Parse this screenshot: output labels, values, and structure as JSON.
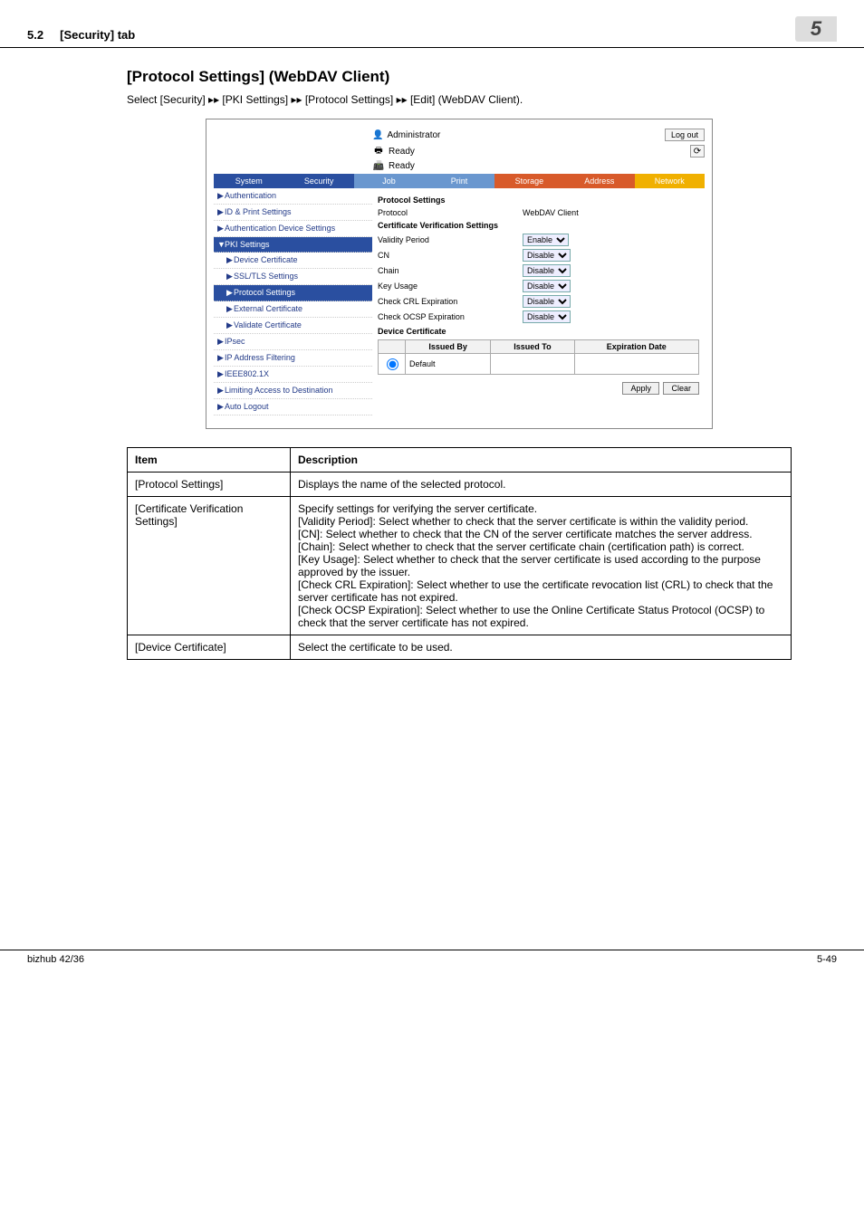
{
  "header": {
    "section": "5.2",
    "section_title": "[Security] tab",
    "chapter_badge": "5"
  },
  "page_title": "[Protocol Settings] (WebDAV Client)",
  "intro_prefix": "Select [Security] ",
  "intro_sep": "▸▸",
  "intro_p1": " [PKI Settings] ",
  "intro_p2": " [Protocol Settings] ",
  "intro_p3": " [Edit] (WebDAV Client).",
  "screenshot": {
    "administrator_label": "Administrator",
    "logout_label": "Log out",
    "ready_label": "Ready",
    "tabs": {
      "system": "System",
      "security": "Security",
      "job": "Job",
      "print": "Print",
      "storage": "Storage",
      "address": "Address",
      "network": "Network"
    },
    "sidebar": {
      "authentication": "Authentication",
      "id_print": "ID & Print Settings",
      "auth_device": "Authentication Device Settings",
      "pki_settings": "PKI Settings",
      "device_cert": "Device Certificate",
      "ssl_tls": "SSL/TLS Settings",
      "protocol_settings": "Protocol Settings",
      "external_cert": "External Certificate",
      "validate_cert": "Validate Certificate",
      "ipsec": "IPsec",
      "ip_filter": "IP Address Filtering",
      "ieee": "IEEE802.1X",
      "limiting": "Limiting Access to Destination",
      "auto_logout": "Auto Logout"
    },
    "main": {
      "protocol_settings_title": "Protocol Settings",
      "protocol_label": "Protocol",
      "protocol_value": "WebDAV Client",
      "cert_verif_title": "Certificate Verification Settings",
      "validity_period": "Validity Period",
      "cn": "CN",
      "chain": "Chain",
      "key_usage": "Key Usage",
      "check_crl": "Check CRL Expiration",
      "check_ocsp": "Check OCSP Expiration",
      "enable": "Enable",
      "disable": "Disable",
      "device_certificate_title": "Device Certificate",
      "issued_by": "Issued By",
      "issued_to": "Issued To",
      "expiration_date": "Expiration Date",
      "default_label": "Default",
      "apply": "Apply",
      "clear": "Clear"
    }
  },
  "desc_table": {
    "head_item": "Item",
    "head_desc": "Description",
    "rows": [
      {
        "item": "[Protocol Settings]",
        "desc": "Displays the name of the selected protocol."
      },
      {
        "item": "[Certificate Verification Settings]",
        "desc": "Specify settings for verifying the server certificate.\n[Validity Period]: Select whether to check that the server certificate is within the validity period.\n[CN]: Select whether to check that the CN of the server certificate matches the server address.\n[Chain]: Select whether to check that the server certificate chain (certification path) is correct.\n[Key Usage]: Select whether to check that the server certificate is used according to the purpose approved by the issuer.\n[Check CRL Expiration]: Select whether to use the certificate revocation list (CRL) to check that the server certificate has not expired.\n[Check OCSP Expiration]: Select whether to use the Online Certificate Status Protocol (OCSP) to check that the server certificate has not expired."
      },
      {
        "item": "[Device Certificate]",
        "desc": "Select the certificate to be used."
      }
    ]
  },
  "footer": {
    "left": "bizhub 42/36",
    "right": "5-49"
  }
}
